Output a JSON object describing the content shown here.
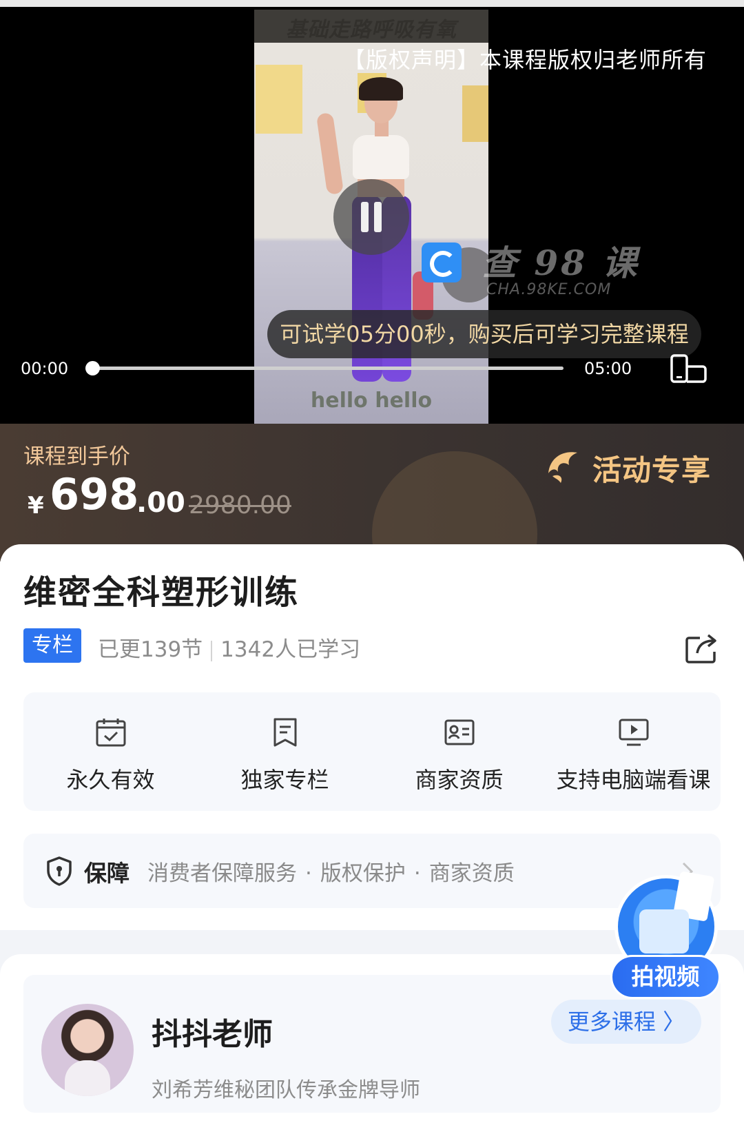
{
  "player": {
    "copyright": "【版权声明】本课程版权归老师所有",
    "video_banner_text": "基础走路呼吸有氧",
    "video_bottom_text": "hello hello",
    "watermark_text": "查 98 课",
    "watermark_sub": "CHA.98KE.COM",
    "trial_tip": "可试学05分00秒，购买后可学习完整课程",
    "current_time": "00:00",
    "total_time": "05:00",
    "progress": 0
  },
  "price": {
    "label": "课程到手价",
    "currency": "¥",
    "main": "698",
    "cents": ".00",
    "original": "2980.00",
    "promo_label": "活动专享",
    "accent_color": "#f2c89a"
  },
  "course": {
    "title": "维密全科塑形训练",
    "tag": "专栏",
    "updated": "已更139节",
    "learners": "1342人已学习"
  },
  "features": [
    {
      "label": "永久有效",
      "icon": "calendar-check-icon"
    },
    {
      "label": "独家专栏",
      "icon": "bookmark-doc-icon"
    },
    {
      "label": "商家资质",
      "icon": "id-card-icon"
    },
    {
      "label": "支持电脑端看课",
      "icon": "monitor-play-icon"
    }
  ],
  "guarantee": {
    "title": "保障",
    "items": [
      "消费者保障服务",
      "版权保护",
      "商家资质"
    ],
    "separator": "·"
  },
  "floating": {
    "label": "拍视频"
  },
  "teacher": {
    "name": "抖抖老师",
    "description": "刘希芳维秘团队传承金牌导师",
    "more_label": "更多课程 〉"
  },
  "colors": {
    "brand_blue": "#2d74f0",
    "price_band": "#3b3330",
    "promo_gold": "#f4c583"
  }
}
